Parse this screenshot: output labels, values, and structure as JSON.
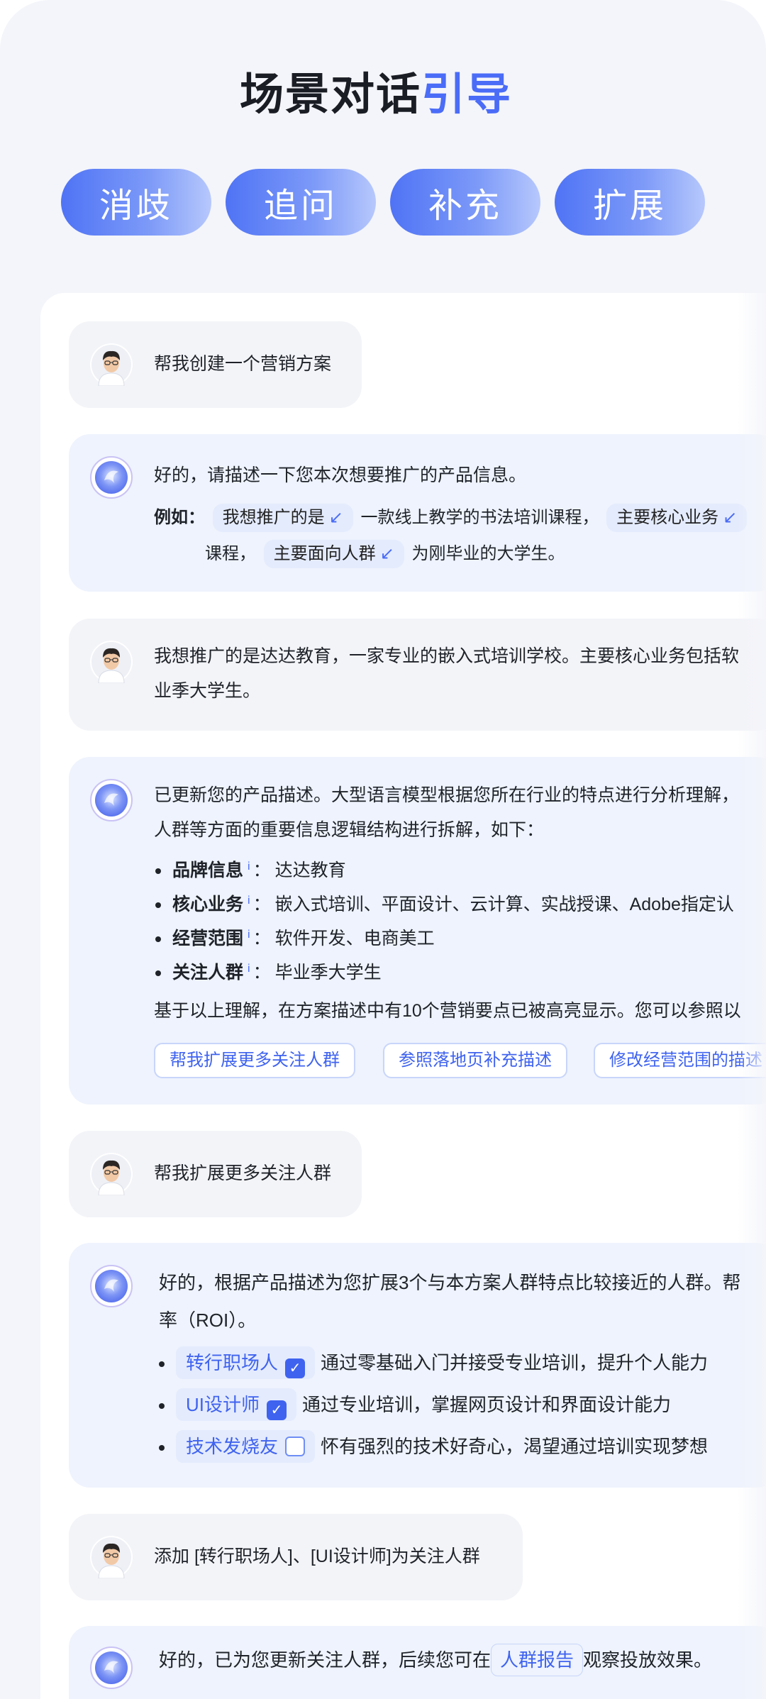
{
  "header": {
    "title_main": "场景对话",
    "title_accent": "引导"
  },
  "tabs": [
    {
      "label": "消歧"
    },
    {
      "label": "追问"
    },
    {
      "label": "补充"
    },
    {
      "label": "扩展"
    }
  ],
  "conversation": {
    "m1": {
      "text": "帮我创建一个营销方案"
    },
    "m2": {
      "line1": "好的，请描述一下您本次想要推广的产品信息。",
      "example_label": "例如：",
      "chip1": "我想推广的是",
      "text1": "一款线上教学的书法培训课程，",
      "chip2": "主要核心业务",
      "text2": "课程，",
      "chip3": "主要面向人群",
      "text3": "为刚毕业的大学生。",
      "arrow": "↙"
    },
    "m3": {
      "line1": "我想推广的是达达教育，一家专业的嵌入式培训学校。主要核心业务包括软",
      "line2": "业季大学生。"
    },
    "m4": {
      "line1": "已更新您的产品描述。大型语言模型根据您所在行业的特点进行分析理解，",
      "line2": "人群等方面的重要信息逻辑结构进行拆解，如下：",
      "items": [
        {
          "label": "品牌信息",
          "info": "i",
          "sep": "：",
          "value": "达达教育"
        },
        {
          "label": "核心业务",
          "info": "i",
          "sep": "：",
          "value": "嵌入式培训、平面设计、云计算、实战授课、Adobe指定认"
        },
        {
          "label": "经营范围",
          "info": "i",
          "sep": "：",
          "value": "软件开发、电商美工"
        },
        {
          "label": "关注人群",
          "info": "i",
          "sep": "：",
          "value": "毕业季大学生"
        }
      ],
      "summary": "基于以上理解，在方案描述中有10个营销要点已被高亮显示。您可以参照以",
      "suggestions": [
        "帮我扩展更多关注人群",
        "参照落地页补充描述",
        "修改经营范围的描述"
      ]
    },
    "m5": {
      "text": "帮我扩展更多关注人群"
    },
    "m6": {
      "line1": "好的，根据产品描述为您扩展3个与本方案人群特点比较接近的人群。帮",
      "line2": "率（ROI）。",
      "items": [
        {
          "tag": "转行职场人",
          "checked": true,
          "desc": "通过零基础入门并接受专业培训，提升个人能力"
        },
        {
          "tag": "UI设计师",
          "checked": true,
          "desc": "通过专业培训，掌握网页设计和界面设计能力"
        },
        {
          "tag": "技术发烧友",
          "checked": false,
          "desc": "怀有强烈的技术好奇心，渴望通过培训实现梦想"
        }
      ],
      "check_mark": "✓"
    },
    "m7": {
      "text": "添加 [转行职场人]、[UI设计师]为关注人群"
    },
    "m8": {
      "pre": "好的，已为您更新关注人群，后续您可在",
      "link": "人群报告",
      "post": "观察投放效果。"
    }
  }
}
